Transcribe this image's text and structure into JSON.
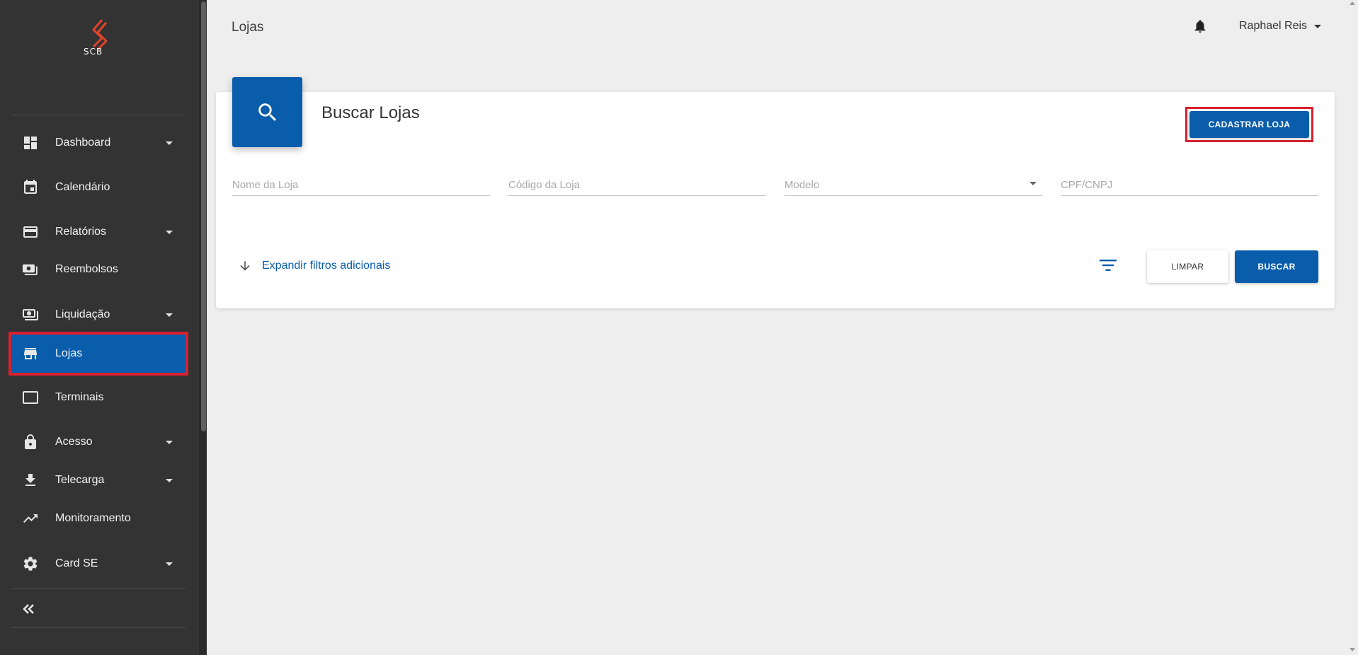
{
  "brand": {
    "logo_text": "SCB"
  },
  "sidebar": {
    "items": [
      {
        "label": "Dashboard",
        "icon": "dashboard-icon",
        "has_submenu": true
      },
      {
        "label": "Calendário",
        "icon": "calendar-icon",
        "has_submenu": false
      },
      {
        "label": "Relatórios",
        "icon": "credit-card-icon",
        "has_submenu": true
      },
      {
        "label": "Reembolsos",
        "icon": "refund-icon",
        "has_submenu": false
      },
      {
        "label": "Liquidação",
        "icon": "money-icon",
        "has_submenu": true
      },
      {
        "label": "Lojas",
        "icon": "store-icon",
        "has_submenu": false,
        "active": true
      },
      {
        "label": "Terminais",
        "icon": "terminal-icon",
        "has_submenu": false
      },
      {
        "label": "Acesso",
        "icon": "lock-icon",
        "has_submenu": true
      },
      {
        "label": "Telecarga",
        "icon": "download-icon",
        "has_submenu": true
      },
      {
        "label": "Monitoramento",
        "icon": "trending-up-icon",
        "has_submenu": false
      },
      {
        "label": "Card SE",
        "icon": "gear-icon",
        "has_submenu": true
      }
    ],
    "collapse_icon": "double-chevron-left-icon"
  },
  "header": {
    "page_title": "Lojas",
    "user_name": "Raphael Reis",
    "notification_icon": "bell-icon"
  },
  "search_card": {
    "title": "Buscar Lojas",
    "register_button": "CADASTRAR LOJA",
    "fields": {
      "store_name": {
        "placeholder": "Nome da Loja",
        "value": ""
      },
      "store_code": {
        "placeholder": "Código da Loja",
        "value": ""
      },
      "model": {
        "placeholder": "Modelo",
        "value": ""
      },
      "cpf_cnpj": {
        "placeholder": "CPF/CNPJ",
        "value": ""
      }
    },
    "expand_filters": "Expandir filtros adicionais",
    "clear_button": "LIMPAR",
    "search_button": "BUSCAR"
  },
  "colors": {
    "sidebar_bg": "#333333",
    "primary": "#0a5dab",
    "highlight": "#d8202f",
    "logo_accent": "#e0442b",
    "background": "#eeeeee"
  }
}
